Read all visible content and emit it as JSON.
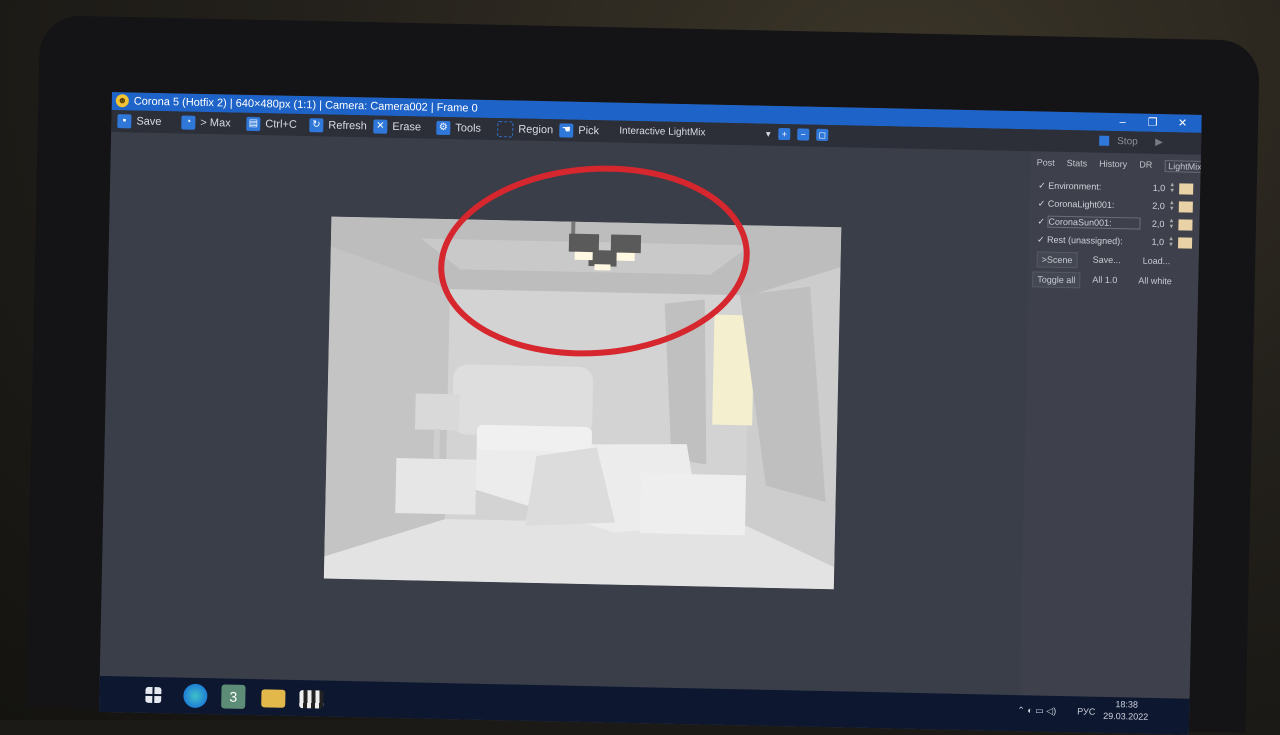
{
  "window": {
    "title": "Corona 5 (Hotfix 2) | 640×480px (1:1) | Camera: Camera002 | Frame 0",
    "minimize_icon": "minimize-icon",
    "maximize_icon": "maximize-icon",
    "close_icon": "close-icon"
  },
  "toolbar": {
    "save": "Save",
    "max": "> Max",
    "copy": "Ctrl+C",
    "refresh": "Refresh",
    "erase": "Erase",
    "tools": "Tools",
    "region": "Region",
    "pick": "Pick",
    "mode_select": "Interactive LightMix",
    "stop": "Stop"
  },
  "panel": {
    "tabs": [
      "Post",
      "Stats",
      "History",
      "DR",
      "LightMix"
    ],
    "active_tab": "LightMix",
    "lights": [
      {
        "label": "Environment:",
        "value": "1,0",
        "color": "#e8d2a6"
      },
      {
        "label": "CoronaLight001:",
        "value": "2,0",
        "color": "#e8d2a6"
      },
      {
        "label": "CoronaSun001:",
        "value": "2,0",
        "color": "#e8d2a6"
      },
      {
        "label": "Rest (unassigned):",
        "value": "1,0",
        "color": "#e8d2a6"
      }
    ],
    "buttons_row1": [
      ">Scene",
      "Save...",
      "Load..."
    ],
    "buttons_row2": [
      "Toggle all",
      "All 1.0",
      "All white"
    ]
  },
  "taskbar": {
    "apps": [
      "windows-start-icon",
      "edge-icon",
      "3dsmax-icon",
      "file-explorer-icon",
      "clapper-icon"
    ],
    "lang": "РУС",
    "time": "18:38",
    "date": "29.03.2022"
  },
  "colors": {
    "titlebar": "#1e63c8",
    "annotation": "#d6262e"
  }
}
